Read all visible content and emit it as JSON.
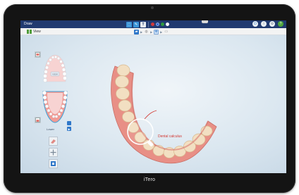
{
  "device": {
    "brand": "iTero"
  },
  "titlebar": {
    "title": "Draw",
    "tools": [
      {
        "name": "cursor-tool",
        "color": "#3a93d8",
        "glyph": "⬚"
      },
      {
        "name": "pen-tool",
        "color": "#3a93d8",
        "glyph": "✎"
      },
      {
        "name": "text-tool",
        "color": "#e9eef3",
        "glyph": "T"
      }
    ],
    "pen_colors": [
      "#d23a3a",
      "#2f65d2",
      "#2e9c3e",
      "#ffffff"
    ],
    "right_icons": [
      {
        "name": "power-icon",
        "glyph": "⏻",
        "color": "#2c78c9"
      },
      {
        "name": "info-icon",
        "glyph": "i",
        "color": "#6b7a8a"
      },
      {
        "name": "settings-icon",
        "glyph": "⚙",
        "color": "#6b7a8a"
      },
      {
        "name": "help-icon",
        "glyph": "?",
        "color": "#4ea53b"
      }
    ]
  },
  "viewbar": {
    "label": "View",
    "crumbs": [
      {
        "name": "folder-icon",
        "glyph": "▰",
        "color": "#2f77c9"
      },
      {
        "name": "scan-icon",
        "glyph": "◍",
        "color": "#8b8b8b"
      },
      {
        "name": "zoom-icon",
        "glyph": "⊕",
        "color": "#2f77c9"
      },
      {
        "name": "display-icon",
        "glyph": "▭",
        "color": "#8b8b8b"
      }
    ]
  },
  "navigator": {
    "lower_label": "Lower",
    "center_tag": "VIEW"
  },
  "annotation": {
    "label": "Dental calculus",
    "color": "#d2352f"
  },
  "colors": {
    "gum": "#e88f86",
    "tooth": "#f2dfc2",
    "accent": "#213a70"
  }
}
